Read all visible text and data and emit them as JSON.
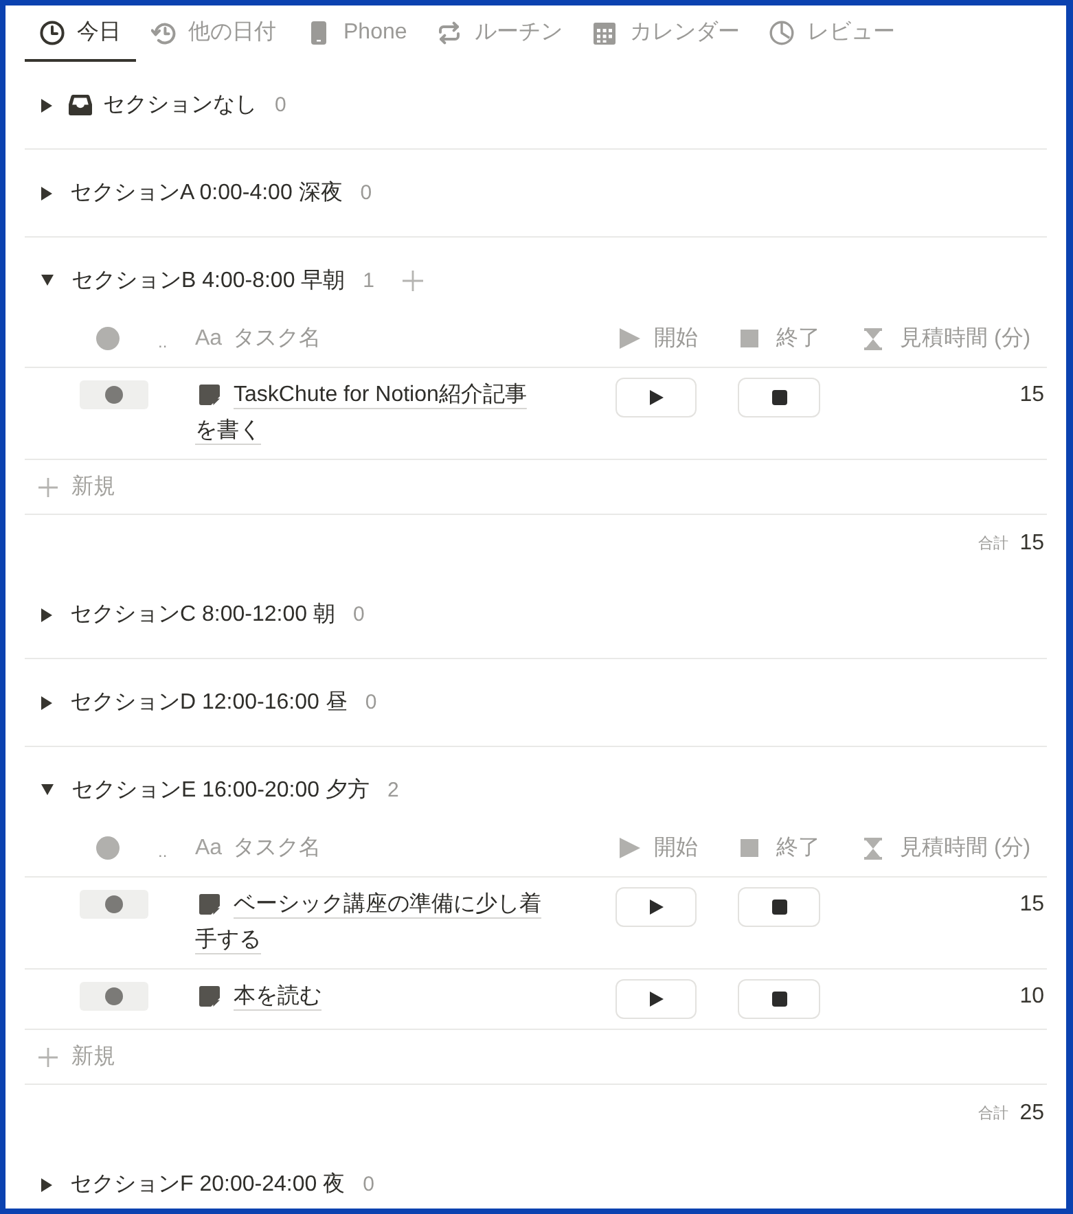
{
  "tabs": [
    {
      "label": "今日",
      "selected": true
    },
    {
      "label": "他の日付",
      "selected": false
    },
    {
      "label": "Phone",
      "selected": false
    },
    {
      "label": "ルーチン",
      "selected": false
    },
    {
      "label": "カレンダー",
      "selected": false
    },
    {
      "label": "レビュー",
      "selected": false
    }
  ],
  "sections": [
    {
      "title": "セクションなし",
      "count": "0",
      "expanded": false,
      "hovered": false
    },
    {
      "title": "セクションA 0:00-4:00 深夜",
      "count": "0",
      "expanded": false,
      "hovered": false
    },
    {
      "title": "セクションB 4:00-8:00 早朝",
      "count": "1",
      "expanded": true,
      "hovered": true,
      "table": {
        "columns": [
          {
            "kind": "status"
          },
          {
            "kind": "more",
            "label": ".."
          },
          {
            "kind": "title",
            "prefix": "Aa",
            "label": "タスク名"
          },
          {
            "kind": "start",
            "label": "開始"
          },
          {
            "kind": "stop",
            "label": "終了"
          },
          {
            "kind": "estimate",
            "label": "見積時間 (分)"
          }
        ],
        "rows": [
          {
            "title": "TaskChute for Notion紹介記事を書く",
            "estimate": "15"
          }
        ],
        "new_label": "新規",
        "total": {
          "label": "合計",
          "value": "15"
        }
      }
    },
    {
      "title": "セクションC 8:00-12:00 朝",
      "count": "0",
      "expanded": false,
      "hovered": false
    },
    {
      "title": "セクションD 12:00-16:00 昼",
      "count": "0",
      "expanded": false,
      "hovered": false
    },
    {
      "title": "セクションE 16:00-20:00 夕方",
      "count": "2",
      "expanded": true,
      "hovered": false,
      "table": {
        "columns": [
          {
            "kind": "status"
          },
          {
            "kind": "more",
            "label": ".."
          },
          {
            "kind": "title",
            "prefix": "Aa",
            "label": "タスク名"
          },
          {
            "kind": "start",
            "label": "開始"
          },
          {
            "kind": "stop",
            "label": "終了"
          },
          {
            "kind": "estimate",
            "label": "見積時間 (分)"
          }
        ],
        "rows": [
          {
            "title": "ベーシック講座の準備に少し着手する",
            "estimate": "15"
          },
          {
            "title": "本を読む",
            "estimate": "10"
          }
        ],
        "new_label": "新規",
        "total": {
          "label": "合計",
          "value": "25"
        }
      }
    },
    {
      "title": "セクションF 20:00-24:00 夜",
      "count": "0",
      "expanded": false,
      "hovered": false
    }
  ]
}
